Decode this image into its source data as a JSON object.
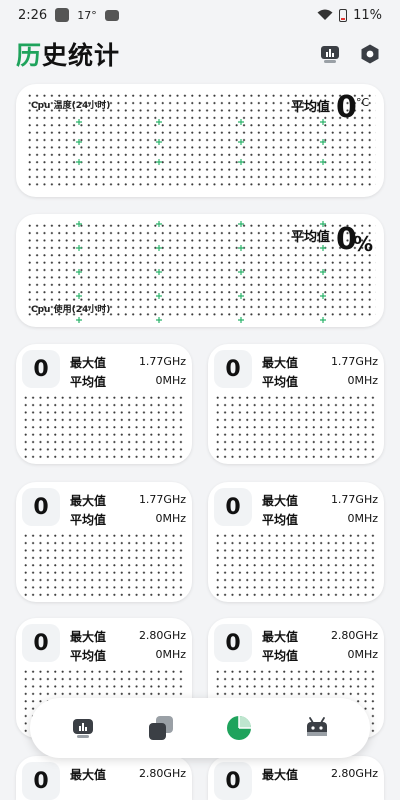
{
  "status_bar": {
    "time": "2:26",
    "temp": "17°",
    "battery": "11%"
  },
  "header": {
    "title_accent": "历",
    "title_rest": "史统计",
    "icons": [
      "stats-icon",
      "settings-icon"
    ]
  },
  "temp_card": {
    "label": "Cpu 温度(24小时)",
    "avg_label": "平均值",
    "value": "0",
    "unit": "°C"
  },
  "usage_card": {
    "label": "Cpu 使用(24小时)",
    "avg_label": "平均值",
    "value": "0",
    "unit": "%"
  },
  "freq_cards": [
    {
      "value": "0",
      "max_label": "最大值",
      "max_value": "1.77GHz",
      "avg_label": "平均值",
      "avg_value": "0MHz"
    },
    {
      "value": "0",
      "max_label": "最大值",
      "max_value": "1.77GHz",
      "avg_label": "平均值",
      "avg_value": "0MHz"
    },
    {
      "value": "0",
      "max_label": "最大值",
      "max_value": "1.77GHz",
      "avg_label": "平均值",
      "avg_value": "0MHz"
    },
    {
      "value": "0",
      "max_label": "最大值",
      "max_value": "1.77GHz",
      "avg_label": "平均值",
      "avg_value": "0MHz"
    },
    {
      "value": "0",
      "max_label": "最大值",
      "max_value": "2.80GHz",
      "avg_label": "平均值",
      "avg_value": "0MHz"
    },
    {
      "value": "0",
      "max_label": "最大值",
      "max_value": "2.80GHz",
      "avg_label": "平均值",
      "avg_value": "0MHz"
    },
    {
      "value": "0",
      "max_label": "最大值",
      "max_value": "2.80GHz"
    },
    {
      "value": "0",
      "max_label": "最大值",
      "max_value": "2.80GHz"
    }
  ],
  "bottom_nav": {
    "items": [
      "monitor-icon",
      "cards-icon",
      "pie-chart-icon",
      "android-icon"
    ],
    "active_index": 2
  },
  "colors": {
    "accent": "#1fa35c",
    "background": "#f3f4f6",
    "card": "#ffffff"
  }
}
